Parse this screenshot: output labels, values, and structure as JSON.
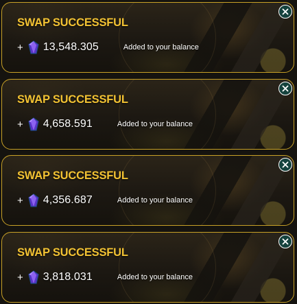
{
  "toasts": [
    {
      "title": "SWAP SUCCESSFUL",
      "plus": "+",
      "amount": "13,548.305",
      "message": "Added to your balance"
    },
    {
      "title": "SWAP SUCCESSFUL",
      "plus": "+",
      "amount": "4,658.591",
      "message": "Added to your balance"
    },
    {
      "title": "SWAP SUCCESSFUL",
      "plus": "+",
      "amount": "4,356.687",
      "message": "Added to your balance"
    },
    {
      "title": "SWAP SUCCESSFUL",
      "plus": "+",
      "amount": "3,818.031",
      "message": "Added to your balance"
    }
  ],
  "icons": {
    "currency": "purple-gem-icon",
    "close": "close-icon"
  },
  "colors": {
    "title": "#f2c233",
    "border": "#c9a227",
    "gem": "#6b3fd6",
    "close_bg": "#15423d"
  }
}
